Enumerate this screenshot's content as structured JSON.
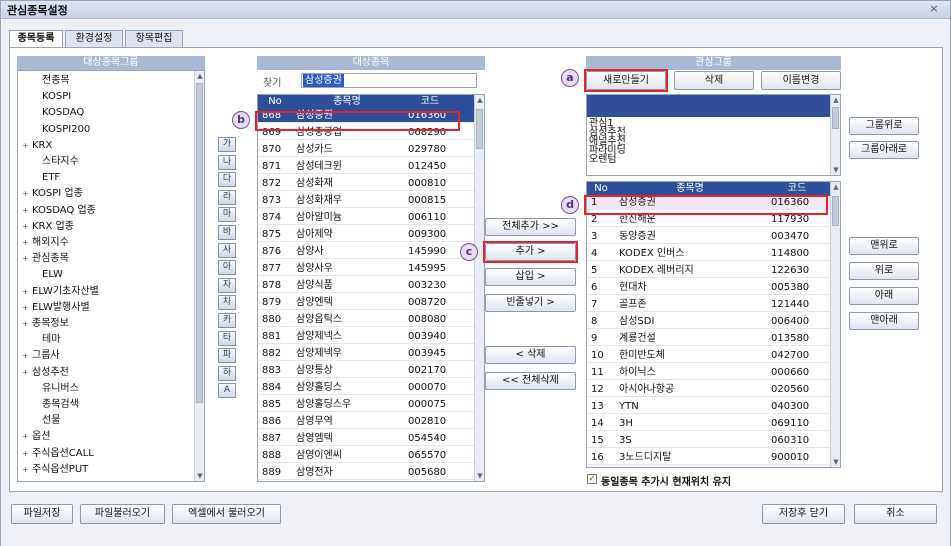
{
  "window": {
    "title": "관심종목설정",
    "close": "×"
  },
  "tabs": [
    "종목등록",
    "환경설정",
    "항목편집"
  ],
  "left_panel": {
    "header": "대상종목그룹",
    "items": [
      {
        "label": "전종목",
        "exp": ""
      },
      {
        "label": "KOSPI",
        "exp": ""
      },
      {
        "label": "KOSDAQ",
        "exp": ""
      },
      {
        "label": "KOSPI200",
        "exp": ""
      },
      {
        "label": "KRX",
        "exp": "+"
      },
      {
        "label": "스타지수",
        "exp": ""
      },
      {
        "label": "ETF",
        "exp": ""
      },
      {
        "label": "KOSPI 업종",
        "exp": "+"
      },
      {
        "label": "KOSDAQ 업종",
        "exp": "+"
      },
      {
        "label": "KRX 업종",
        "exp": "+"
      },
      {
        "label": "해외지수",
        "exp": "+"
      },
      {
        "label": "관심종목",
        "exp": "+"
      },
      {
        "label": "ELW",
        "exp": ""
      },
      {
        "label": "ELW기초자산별",
        "exp": "+"
      },
      {
        "label": "ELW발행사별",
        "exp": "+"
      },
      {
        "label": "종목정보",
        "exp": "+"
      },
      {
        "label": "테마",
        "exp": ""
      },
      {
        "label": "그룹사",
        "exp": "+"
      },
      {
        "label": "삼성추천",
        "exp": "+"
      },
      {
        "label": "유니버스",
        "exp": ""
      },
      {
        "label": "종목검색",
        "exp": ""
      },
      {
        "label": "선물",
        "exp": ""
      },
      {
        "label": "옵션",
        "exp": "+"
      },
      {
        "label": "주식옵션CALL",
        "exp": "+"
      },
      {
        "label": "주식옵션PUT",
        "exp": "+"
      }
    ]
  },
  "korean_index": [
    "가",
    "나",
    "다",
    "라",
    "마",
    "바",
    "사",
    "아",
    "자",
    "차",
    "카",
    "타",
    "파",
    "하",
    "A"
  ],
  "middle_panel": {
    "header": "대상종목",
    "search_label": "찾기",
    "search_value": "삼성증권",
    "columns": [
      "No",
      "종목명",
      "코드"
    ],
    "rows": [
      [
        "868",
        "삼성증권",
        "016360"
      ],
      [
        "869",
        "삼성중공업",
        "068290"
      ],
      [
        "870",
        "삼성카드",
        "029780"
      ],
      [
        "871",
        "삼성테크윈",
        "012450"
      ],
      [
        "872",
        "삼성화재",
        "000810"
      ],
      [
        "873",
        "삼성화재우",
        "000815"
      ],
      [
        "874",
        "삼아알미늄",
        "006110"
      ],
      [
        "875",
        "삼아제약",
        "009300"
      ],
      [
        "876",
        "삼양사",
        "145990"
      ],
      [
        "877",
        "삼양사우",
        "145995"
      ],
      [
        "878",
        "삼양식품",
        "003230"
      ],
      [
        "879",
        "삼양엔텍",
        "008720"
      ],
      [
        "880",
        "삼양옵틱스",
        "008080"
      ],
      [
        "881",
        "삼양제넥스",
        "003940"
      ],
      [
        "882",
        "삼양제넥우",
        "003945"
      ],
      [
        "883",
        "삼양통상",
        "002170"
      ],
      [
        "884",
        "삼양홀딩스",
        "000070"
      ],
      [
        "885",
        "삼양홀딩스우",
        "000075"
      ],
      [
        "886",
        "삼영무역",
        "002810"
      ],
      [
        "887",
        "삼영엠텍",
        "054540"
      ],
      [
        "888",
        "삼영이엔씨",
        "065570"
      ],
      [
        "889",
        "삼영전자",
        "005680"
      ]
    ]
  },
  "transfer_buttons": {
    "add_all": "전체추가 >>",
    "add": "추가 >",
    "insert": "삽입 >",
    "blank_insert": "빈줄넣기 >",
    "delete": "< 삭제",
    "delete_all": "<< 전체삭제"
  },
  "right_panel": {
    "header": "관심그룹",
    "new_button": "새로만들기",
    "delete_button": "삭제",
    "rename_button": "이름변경",
    "groups": [
      "관심1",
      "삼성추천",
      "애널추천",
      "파라미딩",
      "오렌텀"
    ],
    "columns": [
      "No",
      "종목명",
      "코드"
    ],
    "rows": [
      [
        "1",
        "삼성증권",
        "016360"
      ],
      [
        "2",
        "한진해운",
        "117930"
      ],
      [
        "3",
        "동양증권",
        "003470"
      ],
      [
        "4",
        "KODEX 인버스",
        "114800"
      ],
      [
        "5",
        "KODEX 레버리지",
        "122630"
      ],
      [
        "6",
        "현대차",
        "005380"
      ],
      [
        "7",
        "골프존",
        "121440"
      ],
      [
        "8",
        "삼성SDI",
        "006400"
      ],
      [
        "9",
        "계룡건설",
        "013580"
      ],
      [
        "10",
        "한미반도체",
        "042700"
      ],
      [
        "11",
        "하이닉스",
        "000660"
      ],
      [
        "12",
        "아시아나항공",
        "020560"
      ],
      [
        "13",
        "YTN",
        "040300"
      ],
      [
        "14",
        "3H",
        "069110"
      ],
      [
        "15",
        "3S",
        "060310"
      ],
      [
        "16",
        "3노드디지탈",
        "900010"
      ]
    ],
    "checkbox_label": "동일종목 추가시 현재위치 유지",
    "checkbox_mark": "✓"
  },
  "side_buttons": {
    "group_up": "그룹위로",
    "group_down": "그룹아래로",
    "top": "맨위로",
    "up": "위로",
    "down": "아래",
    "bottom": "맨아래"
  },
  "bottom_buttons": {
    "save_file": "파일저장",
    "load_file": "파일불러오기",
    "load_excel": "엑셀에서 불러오기",
    "save_close": "저장후 닫기",
    "cancel": "취소"
  },
  "badges": [
    "a",
    "b",
    "c",
    "d"
  ],
  "colors": {
    "highlight": "#e2242c",
    "table_header": "#2f4f9a",
    "panel_header": "#a9b8d3",
    "badge": "#7b4f9e"
  }
}
